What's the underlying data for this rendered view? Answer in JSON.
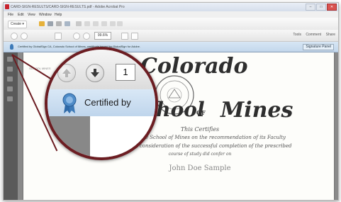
{
  "window": {
    "title": "CARD-SIGN-RESULTS/CARD-SIGN-RESULTS.pdf - Adobe Acrobat Pro",
    "min": "–",
    "max": "□",
    "close": "✕"
  },
  "menu": [
    "File",
    "Edit",
    "View",
    "Window",
    "Help"
  ],
  "toolbar": {
    "create_label": "Create ▾",
    "zoom_value": "99.6%",
    "tabs": [
      "Tools",
      "Comment",
      "Share"
    ]
  },
  "cert_bar": {
    "text": "Certified by GlobalSign CA, Colorado School of Mines, certificate issued by GlobalSign for Adobe.",
    "signature_panel": "Signature Panel"
  },
  "magnifier": {
    "page_number": "1",
    "certified_text": "Certified by"
  },
  "document": {
    "logo_small": "SCHOOL MINES",
    "word_colorado": "Colorado",
    "word_school": "School",
    "word_of": "OF",
    "word_mines": "Mines",
    "certify": "This Certifies",
    "line1": "that the School of Mines on the recommendation of its Faculty",
    "line2": "and in consideration of the successful completion of the prescribed",
    "line3": "course of study did confer on",
    "name": "John Doe Sample"
  },
  "colors": {
    "magnifier_ring": "#6c1d22",
    "cert_bar": "#c8dbee",
    "ribbon": "#3d7ab8"
  }
}
